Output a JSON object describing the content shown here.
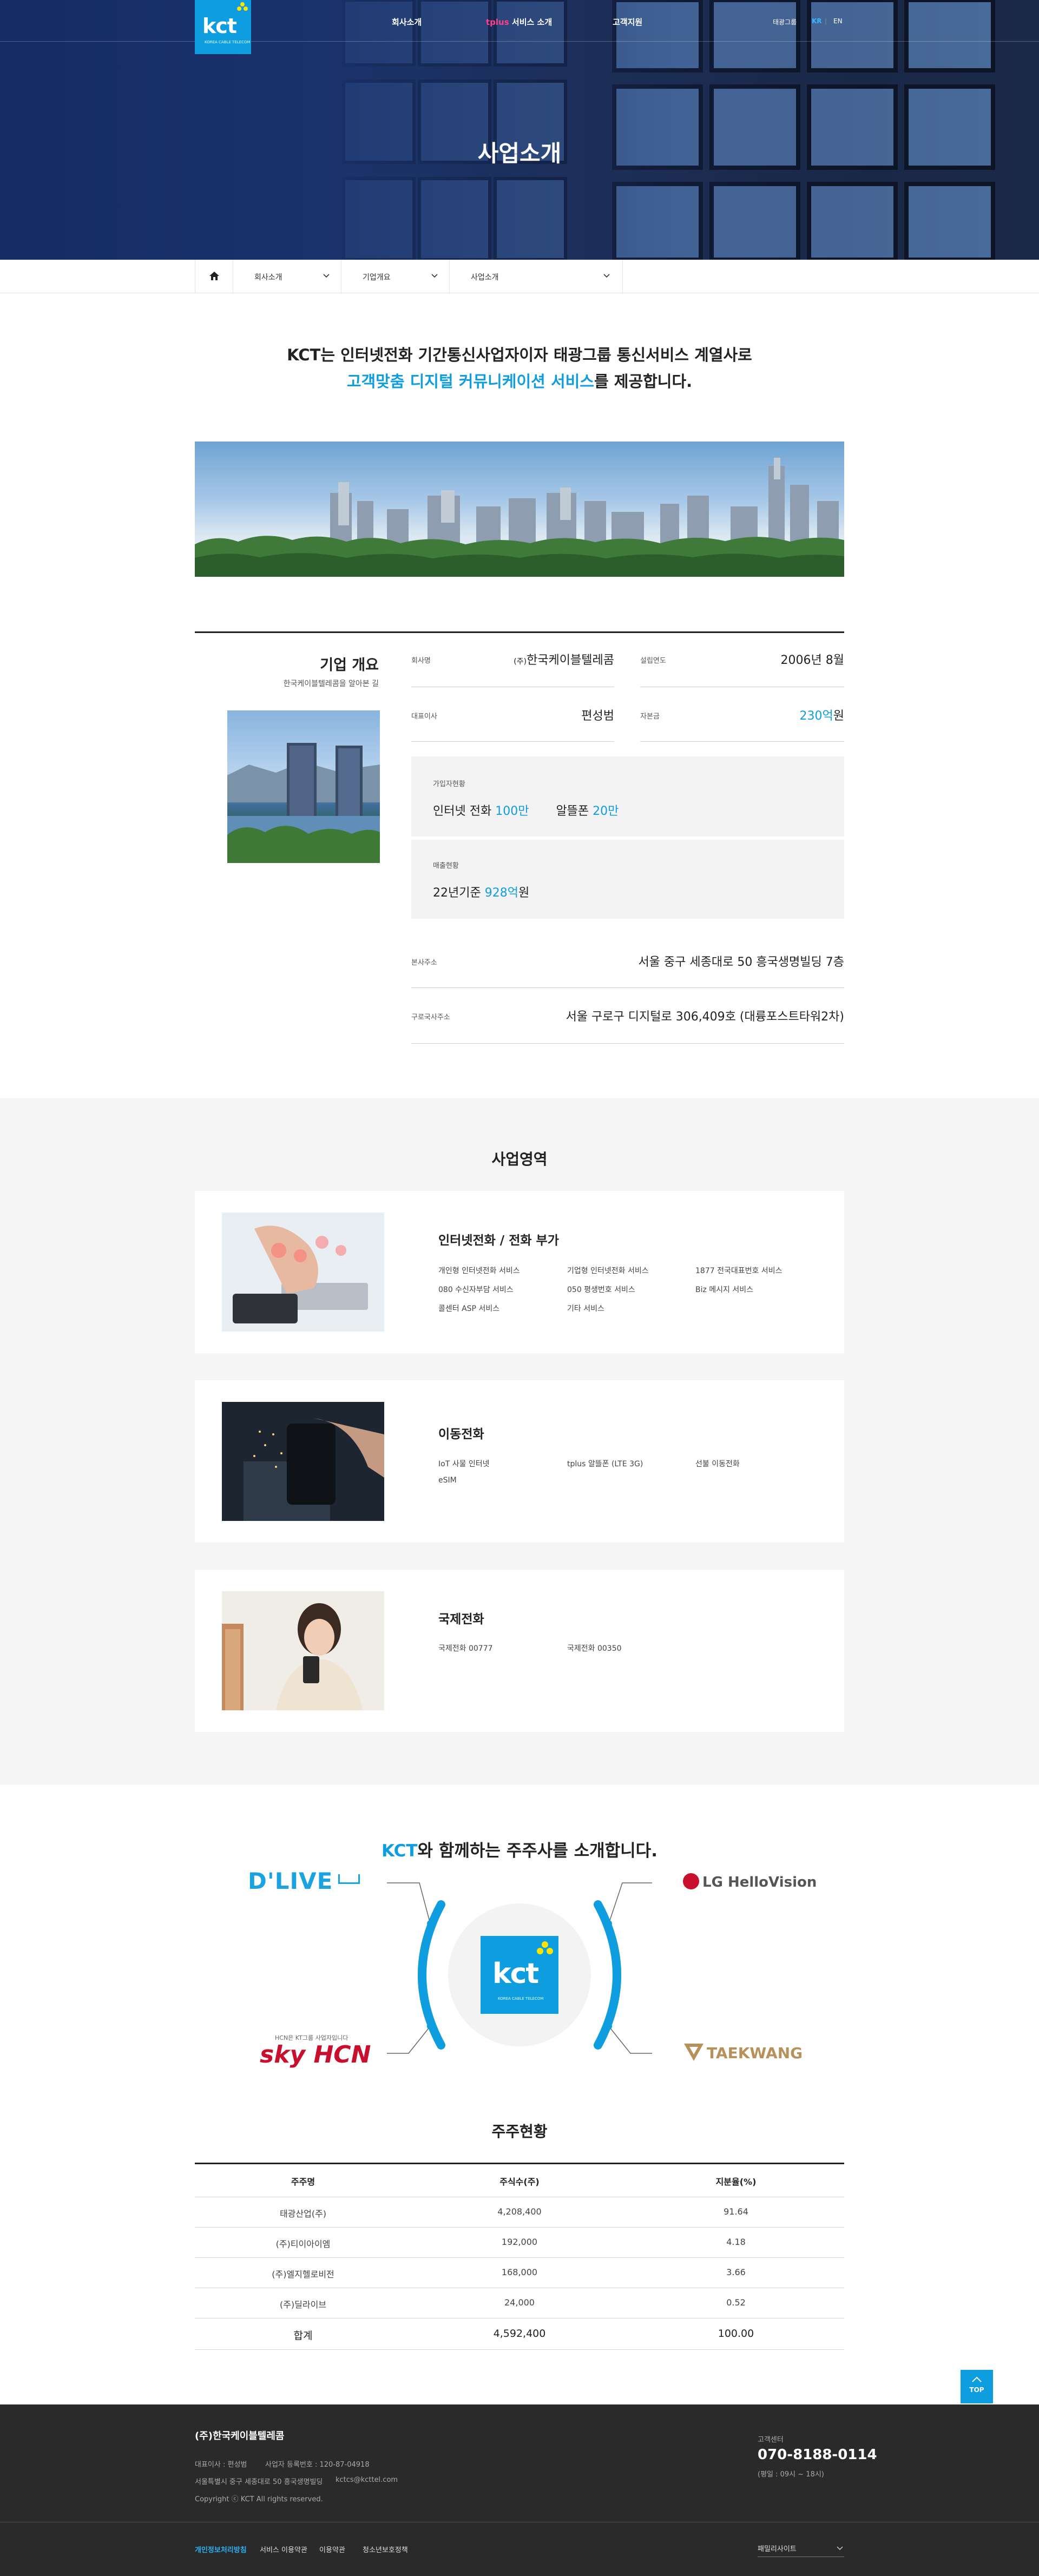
{
  "header": {
    "logo_text": "kct",
    "logo_sub": "KOREA CABLE TELECOM",
    "nav": [
      {
        "label": "회사소개"
      },
      {
        "prefix": "tplus",
        "label": "서비스 소개"
      },
      {
        "label": "고객지원"
      }
    ],
    "lang": {
      "group": "태광그룹",
      "kr": "KR",
      "en": "EN"
    },
    "hero_title": "사업소개"
  },
  "breadcrumb": {
    "items": [
      "회사소개",
      "기업개요",
      "사업소개"
    ]
  },
  "intro": {
    "line1": "KCT는 인터넷전화 기간통신사업자이자 태광그룹 통신서비스 계열사로",
    "line2_highlight": "고객맞춤 디지털 커뮤니케이션 서비스",
    "line2_rest": "를 제공합니다."
  },
  "overview": {
    "title": "기업 개요",
    "subtitle": "한국케이블텔레콤을 알아본 길",
    "company_label": "회사명",
    "company_prefix": "(주)",
    "company_value": "한국케이블텔레콤",
    "founded_label": "설립연도",
    "founded_value": "2006년 8월",
    "ceo_label": "대표이사",
    "ceo_value": "편성범",
    "capital_label": "자본금",
    "capital_num": "230억",
    "capital_unit": "원",
    "subscribers_label": "가입자현황",
    "internet_label": "인터넷 전화",
    "internet_num": "100만",
    "mvno_label": "알뜰폰",
    "mvno_num": "20만",
    "sales_label": "매출현황",
    "sales_prefix": "22년기준",
    "sales_num": "928억",
    "sales_unit": "원",
    "hq_label": "본사주소",
    "hq_value": "서울 중구 세종대로 50 흥국생명빌딩 7층",
    "guro_label": "구로국사주소",
    "guro_value": "서울 구로구 디지털로 306,409호 (대륭포스트타워2차)"
  },
  "business": {
    "title": "사업영역",
    "cards": [
      {
        "title": "인터넷전화 / 전화 부가",
        "items": [
          "개인형 인터넷전화 서비스",
          "기업형 인터넷전화 서비스",
          "1877 전국대표번호 서비스",
          "080 수신자부담 서비스",
          "050 평생번호 서비스",
          "Biz 메시지 서비스",
          "콜센터 ASP 서비스",
          "기타 서비스"
        ]
      },
      {
        "title": "이동전화",
        "items": [
          "IoT 사물 인터넷",
          "tplus 알뜰폰 (LTE 3G)",
          "선불 이동전화",
          "eSIM"
        ]
      },
      {
        "title": "국제전화",
        "items": [
          "국제전화 00777",
          "국제전화 00350"
        ]
      }
    ]
  },
  "shareholders": {
    "title_highlight": "KCT",
    "title_rest": "와 함께하는 주주사를 소개합니다.",
    "partners": {
      "dlive": "D'LIVE",
      "lg": "LG HelloVision",
      "skyhcn_small": "HCN은 KT그룹 사업자입니다",
      "skyhcn": "sky HCN",
      "taekwang": "TAEKWANG"
    },
    "center_logo": "kct",
    "center_sub": "KOREA CABLE TELECOM"
  },
  "share_table": {
    "title": "주주현황",
    "headers": [
      "주주명",
      "주식수(주)",
      "지분율(%)"
    ],
    "rows": [
      [
        "태광산업(주)",
        "4,208,400",
        "91.64"
      ],
      [
        "(주)티이아이엠",
        "192,000",
        "4.18"
      ],
      [
        "(주)엘지헬로비전",
        "168,000",
        "3.66"
      ],
      [
        "(주)딜라이브",
        "24,000",
        "0.52"
      ]
    ],
    "total": [
      "합계",
      "4,592,400",
      "100.00"
    ]
  },
  "top_button": "TOP",
  "footer": {
    "company": "(주)한국케이블텔레콤",
    "ceo": "대표이사 : 편성범",
    "biz_no": "사업자 등록번호 : 120-87-04918",
    "address": "서울특별시 중구 세종대로 50 흥국생명빌딩",
    "email": "kctcs@kcttel.com",
    "copyright": "Copyright ⓒ KCT All rights reserved.",
    "cs_label": "고객센터",
    "cs_phone": "070-8188-0114",
    "cs_hours": "(평일 : 09시 ~ 18시)",
    "links": [
      "개인정보처리방침",
      "서비스 이용약관",
      "이용약관",
      "청소년보호정책"
    ],
    "family_site": "패밀리사이트"
  },
  "colors": {
    "accent": "#0e9ee0",
    "hero": "#1b3570",
    "footer": "#2a2a2a",
    "nav_highlight": "#ff3f8a"
  }
}
